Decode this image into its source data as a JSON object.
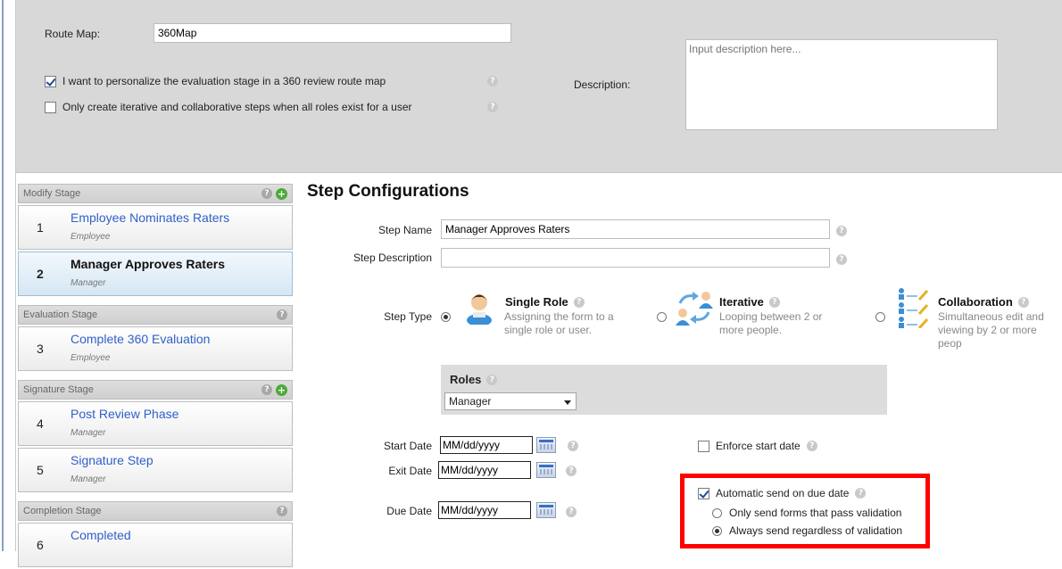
{
  "route_map": {
    "label": "Route Map:",
    "value": "360Map",
    "personalize_label": "I want to personalize the evaluation stage in a 360 review route map",
    "personalize_checked": true,
    "iterative_label": "Only create iterative and collaborative steps when all roles exist for a user",
    "iterative_checked": false,
    "description_label": "Description:",
    "description_placeholder": "Input description here..."
  },
  "stages": [
    {
      "name": "Modify Stage",
      "has_add": true,
      "steps": [
        {
          "num": "1",
          "title": "Employee Nominates Raters",
          "role": "Employee",
          "active": false
        },
        {
          "num": "2",
          "title": "Manager Approves Raters",
          "role": "Manager",
          "active": true
        }
      ]
    },
    {
      "name": "Evaluation Stage",
      "has_add": false,
      "steps": [
        {
          "num": "3",
          "title": "Complete 360 Evaluation",
          "role": "Employee",
          "active": false
        }
      ]
    },
    {
      "name": "Signature Stage",
      "has_add": true,
      "steps": [
        {
          "num": "4",
          "title": "Post Review Phase",
          "role": "Manager",
          "active": false
        },
        {
          "num": "5",
          "title": "Signature Step",
          "role": "Manager",
          "active": false
        }
      ]
    },
    {
      "name": "Completion Stage",
      "has_add": false,
      "steps": [
        {
          "num": "6",
          "title": "Completed",
          "role": "",
          "active": false
        }
      ]
    }
  ],
  "config": {
    "title": "Step Configurations",
    "step_name_label": "Step Name",
    "step_name_value": "Manager Approves Raters",
    "step_desc_label": "Step Description",
    "step_desc_value": "",
    "step_type_label": "Step Type",
    "types": [
      {
        "name": "Single Role",
        "desc": "Assigning the form to a single role or user.",
        "selected": true
      },
      {
        "name": "Iterative",
        "desc": "Looping between 2 or more people.",
        "selected": false
      },
      {
        "name": "Collaboration",
        "desc": "Simultaneous edit and viewing by 2 or more peop",
        "selected": false
      }
    ],
    "roles_title": "Roles",
    "roles_selected": "Manager",
    "start_date_label": "Start Date",
    "exit_date_label": "Exit Date",
    "due_date_label": "Due Date",
    "date_placeholder": "MM/dd/yyyy",
    "enforce_label": "Enforce start date",
    "enforce_checked": false,
    "auto_send_label": "Automatic send on due date",
    "auto_send_checked": true,
    "opt_validation": "Only send forms that pass validation",
    "opt_always": "Always send regardless of validation",
    "selected_option": "always",
    "highlight_color": "#ff0000"
  }
}
